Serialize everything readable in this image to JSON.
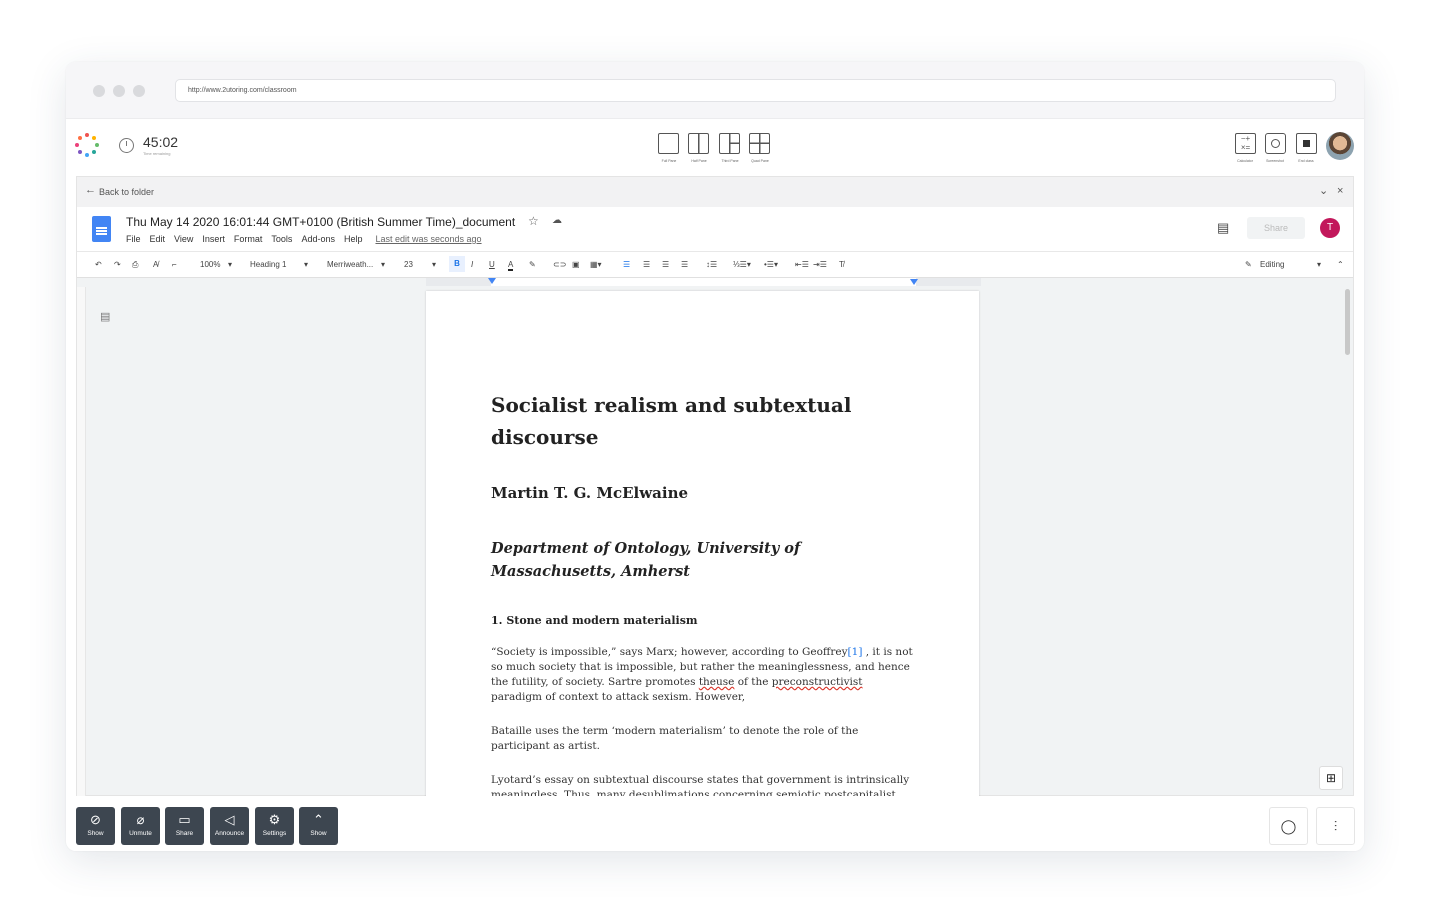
{
  "browser": {
    "url": "http://www.2utoring.com/classroom"
  },
  "session": {
    "timer": "45:02",
    "timer_sub": "Time remaining"
  },
  "panes": [
    "Full Pane",
    "Half Pane",
    "Third Pane",
    "Quad Pane"
  ],
  "tools": [
    "Calculator",
    "Screenshot",
    "End class"
  ],
  "doc_nav": {
    "back": "Back to folder"
  },
  "gdoc": {
    "title": "Thu May 14 2020 16:01:44 GMT+0100 (British Summer Time)_document",
    "menu": [
      "File",
      "Edit",
      "View",
      "Insert",
      "Format",
      "Tools",
      "Add-ons",
      "Help"
    ],
    "last_edit": "Last edit was seconds ago",
    "share": "Share",
    "user_initial": "T",
    "zoom": "100%",
    "style": "Heading 1",
    "font": "Merriweath...",
    "size": "23",
    "mode": "Editing"
  },
  "document": {
    "title": "Socialist realism and subtextual discourse",
    "author": "Martin T. G. McElwaine",
    "affiliation": "Department of Ontology, University of Massachusetts, Amherst",
    "section": "1. Stone and modern materialism",
    "p1a": "“Society is impossible,” says Marx; however, according to Geoffrey",
    "p1cite": "[1]",
    "p1b": " , it is not so much society that is impossible, but rather the meaninglessness, and hence the futility, of society. Sartre promotes ",
    "p1err1": "theuse",
    "p1c": " of the ",
    "p1err2": "preconstructivist",
    "p1d": " paradigm of context to attack sexism. However,",
    "p2": "Bataille uses the term ‘modern materialism’ to denote the role of the participant as artist.",
    "p3": "Lyotard’s essay on subtextual discourse states that government is intrinsically meaningless. Thus, many desublimations concerning semiotic postcapitalist"
  },
  "controls": [
    "Show",
    "Unmute",
    "Share",
    "Announce",
    "Settings",
    "Show"
  ],
  "colors": {
    "accent": "#1a73e8",
    "avatar_user": "#c2185b",
    "control_bg": "#3d4650"
  }
}
